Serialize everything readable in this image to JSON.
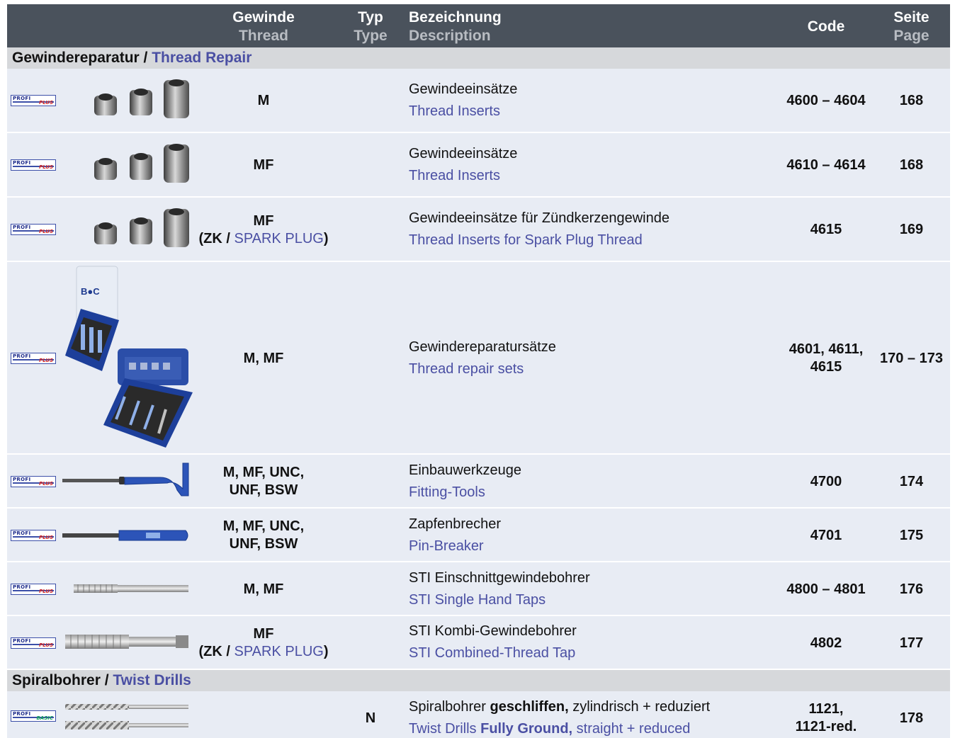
{
  "header": {
    "thread_de": "Gewinde",
    "thread_en": "Thread",
    "type_de": "Typ",
    "type_en": "Type",
    "desc_de": "Bezeichnung",
    "desc_en": "Description",
    "code": "Code",
    "page_de": "Seite",
    "page_en": "Page"
  },
  "sections": [
    {
      "de": "Gewindereparatur /",
      "en": "Thread Repair"
    },
    {
      "de": "Spiralbohrer /",
      "en": "Twist Drills"
    }
  ],
  "logos": {
    "profi": "PROFI",
    "plus": "PLUS",
    "basic": "BASIC"
  },
  "rows": [
    {
      "thread": "M",
      "desc_de": "Gewindeeinsätze",
      "desc_en": "Thread Inserts",
      "code": "4600 – 4604",
      "page": "168",
      "icon": "thread-inserts-image"
    },
    {
      "thread": "MF",
      "desc_de": "Gewindeeinsätze",
      "desc_en": "Thread Inserts",
      "code": "4610 – 4614",
      "page": "168",
      "icon": "thread-inserts-image"
    },
    {
      "thread": "MF",
      "thread_sub_a": "(ZK / ",
      "thread_sub_b": "SPARK PLUG",
      "thread_sub_c": ")",
      "desc_de": "Gewindeeinsätze für Zündkerzengewinde",
      "desc_en": "Thread Inserts for Spark Plug Thread",
      "code": "4615",
      "page": "169",
      "icon": "thread-inserts-image"
    },
    {
      "thread": "M, MF",
      "desc_de": "Gewindereparatursätze",
      "desc_en": "Thread repair sets",
      "code_a": "4601, 4611,",
      "code_b": "4615",
      "page": "170 – 173",
      "icon": "repair-set-cases-image"
    },
    {
      "thread_a": "M, MF, UNC,",
      "thread_b": "UNF, BSW",
      "desc_de": "Einbauwerkzeuge",
      "desc_en": "Fitting-Tools",
      "code": "4700",
      "page": "174",
      "icon": "fitting-tool-image"
    },
    {
      "thread_a": "M, MF, UNC,",
      "thread_b": "UNF, BSW",
      "desc_de": "Zapfenbrecher",
      "desc_en": "Pin-Breaker",
      "code": "4701",
      "page": "175",
      "icon": "pin-breaker-image"
    },
    {
      "thread": "M, MF",
      "desc_de": "STI Einschnittgewindebohrer",
      "desc_en": "STI Single Hand Taps",
      "code": "4800 – 4801",
      "page": "176",
      "icon": "single-tap-image"
    },
    {
      "thread": "MF",
      "thread_sub_a": "(ZK / ",
      "thread_sub_b": "SPARK PLUG",
      "thread_sub_c": ")",
      "desc_de": "STI Kombi-Gewindebohrer",
      "desc_en": "STI Combined-Thread Tap",
      "code": "4802",
      "page": "177",
      "icon": "combined-tap-image"
    },
    {
      "type": "N",
      "desc_de_a": "Spiralbohrer ",
      "desc_de_b": "geschliffen,",
      "desc_de_c": " zylindrisch + reduziert",
      "desc_en_a": "Twist Drills ",
      "desc_en_b": "Fully Ground,",
      "desc_en_c": " straight + reduced",
      "code_a": "1121,",
      "code_b": "1121-red.",
      "page": "178",
      "icon": "twist-drills-image"
    }
  ]
}
